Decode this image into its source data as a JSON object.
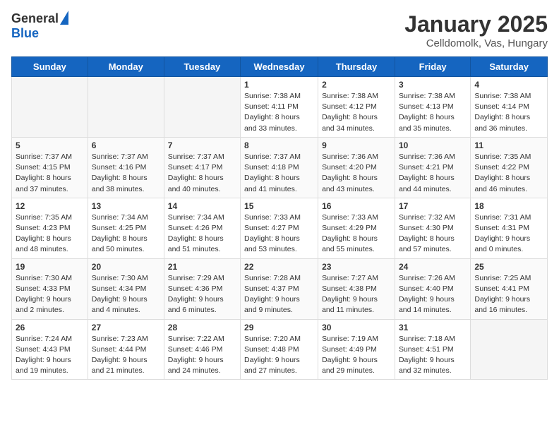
{
  "header": {
    "logo_general": "General",
    "logo_blue": "Blue",
    "title": "January 2025",
    "subtitle": "Celldomolk, Vas, Hungary"
  },
  "days_of_week": [
    "Sunday",
    "Monday",
    "Tuesday",
    "Wednesday",
    "Thursday",
    "Friday",
    "Saturday"
  ],
  "weeks": [
    [
      {
        "day": "",
        "info": ""
      },
      {
        "day": "",
        "info": ""
      },
      {
        "day": "",
        "info": ""
      },
      {
        "day": "1",
        "info": "Sunrise: 7:38 AM\nSunset: 4:11 PM\nDaylight: 8 hours\nand 33 minutes."
      },
      {
        "day": "2",
        "info": "Sunrise: 7:38 AM\nSunset: 4:12 PM\nDaylight: 8 hours\nand 34 minutes."
      },
      {
        "day": "3",
        "info": "Sunrise: 7:38 AM\nSunset: 4:13 PM\nDaylight: 8 hours\nand 35 minutes."
      },
      {
        "day": "4",
        "info": "Sunrise: 7:38 AM\nSunset: 4:14 PM\nDaylight: 8 hours\nand 36 minutes."
      }
    ],
    [
      {
        "day": "5",
        "info": "Sunrise: 7:37 AM\nSunset: 4:15 PM\nDaylight: 8 hours\nand 37 minutes."
      },
      {
        "day": "6",
        "info": "Sunrise: 7:37 AM\nSunset: 4:16 PM\nDaylight: 8 hours\nand 38 minutes."
      },
      {
        "day": "7",
        "info": "Sunrise: 7:37 AM\nSunset: 4:17 PM\nDaylight: 8 hours\nand 40 minutes."
      },
      {
        "day": "8",
        "info": "Sunrise: 7:37 AM\nSunset: 4:18 PM\nDaylight: 8 hours\nand 41 minutes."
      },
      {
        "day": "9",
        "info": "Sunrise: 7:36 AM\nSunset: 4:20 PM\nDaylight: 8 hours\nand 43 minutes."
      },
      {
        "day": "10",
        "info": "Sunrise: 7:36 AM\nSunset: 4:21 PM\nDaylight: 8 hours\nand 44 minutes."
      },
      {
        "day": "11",
        "info": "Sunrise: 7:35 AM\nSunset: 4:22 PM\nDaylight: 8 hours\nand 46 minutes."
      }
    ],
    [
      {
        "day": "12",
        "info": "Sunrise: 7:35 AM\nSunset: 4:23 PM\nDaylight: 8 hours\nand 48 minutes."
      },
      {
        "day": "13",
        "info": "Sunrise: 7:34 AM\nSunset: 4:25 PM\nDaylight: 8 hours\nand 50 minutes."
      },
      {
        "day": "14",
        "info": "Sunrise: 7:34 AM\nSunset: 4:26 PM\nDaylight: 8 hours\nand 51 minutes."
      },
      {
        "day": "15",
        "info": "Sunrise: 7:33 AM\nSunset: 4:27 PM\nDaylight: 8 hours\nand 53 minutes."
      },
      {
        "day": "16",
        "info": "Sunrise: 7:33 AM\nSunset: 4:29 PM\nDaylight: 8 hours\nand 55 minutes."
      },
      {
        "day": "17",
        "info": "Sunrise: 7:32 AM\nSunset: 4:30 PM\nDaylight: 8 hours\nand 57 minutes."
      },
      {
        "day": "18",
        "info": "Sunrise: 7:31 AM\nSunset: 4:31 PM\nDaylight: 9 hours\nand 0 minutes."
      }
    ],
    [
      {
        "day": "19",
        "info": "Sunrise: 7:30 AM\nSunset: 4:33 PM\nDaylight: 9 hours\nand 2 minutes."
      },
      {
        "day": "20",
        "info": "Sunrise: 7:30 AM\nSunset: 4:34 PM\nDaylight: 9 hours\nand 4 minutes."
      },
      {
        "day": "21",
        "info": "Sunrise: 7:29 AM\nSunset: 4:36 PM\nDaylight: 9 hours\nand 6 minutes."
      },
      {
        "day": "22",
        "info": "Sunrise: 7:28 AM\nSunset: 4:37 PM\nDaylight: 9 hours\nand 9 minutes."
      },
      {
        "day": "23",
        "info": "Sunrise: 7:27 AM\nSunset: 4:38 PM\nDaylight: 9 hours\nand 11 minutes."
      },
      {
        "day": "24",
        "info": "Sunrise: 7:26 AM\nSunset: 4:40 PM\nDaylight: 9 hours\nand 14 minutes."
      },
      {
        "day": "25",
        "info": "Sunrise: 7:25 AM\nSunset: 4:41 PM\nDaylight: 9 hours\nand 16 minutes."
      }
    ],
    [
      {
        "day": "26",
        "info": "Sunrise: 7:24 AM\nSunset: 4:43 PM\nDaylight: 9 hours\nand 19 minutes."
      },
      {
        "day": "27",
        "info": "Sunrise: 7:23 AM\nSunset: 4:44 PM\nDaylight: 9 hours\nand 21 minutes."
      },
      {
        "day": "28",
        "info": "Sunrise: 7:22 AM\nSunset: 4:46 PM\nDaylight: 9 hours\nand 24 minutes."
      },
      {
        "day": "29",
        "info": "Sunrise: 7:20 AM\nSunset: 4:48 PM\nDaylight: 9 hours\nand 27 minutes."
      },
      {
        "day": "30",
        "info": "Sunrise: 7:19 AM\nSunset: 4:49 PM\nDaylight: 9 hours\nand 29 minutes."
      },
      {
        "day": "31",
        "info": "Sunrise: 7:18 AM\nSunset: 4:51 PM\nDaylight: 9 hours\nand 32 minutes."
      },
      {
        "day": "",
        "info": ""
      }
    ]
  ]
}
